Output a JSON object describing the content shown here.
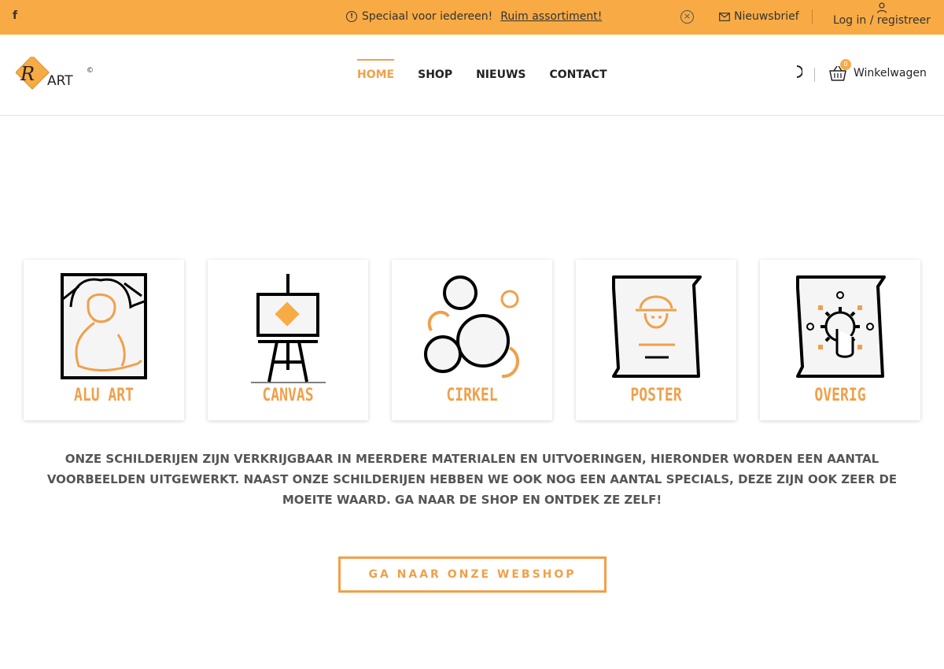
{
  "topbar": {
    "social_icon": "facebook-icon",
    "social_label": "f",
    "promo_text": "Speciaal voor iedereen!",
    "promo_link": "Ruim assortiment!",
    "newsletter_label": "Nieuwsbrief",
    "login_label": "Log in / registreer"
  },
  "header": {
    "logo_text": "ART",
    "logo_mark": "R",
    "logo_copyright": "©",
    "nav": [
      {
        "label": "HOME"
      },
      {
        "label": "SHOP"
      },
      {
        "label": "NIEUWS"
      },
      {
        "label": "CONTACT"
      }
    ],
    "cart_count": "0",
    "cart_label": "Winkelwagen"
  },
  "categories": [
    {
      "label": "ALU ART",
      "icon": "mona-lisa-icon"
    },
    {
      "label": "CANVAS",
      "icon": "easel-icon"
    },
    {
      "label": "CIRKEL",
      "icon": "circles-icon"
    },
    {
      "label": "POSTER",
      "icon": "poster-icon"
    },
    {
      "label": "OVERIG",
      "icon": "touch-gear-icon"
    }
  ],
  "intro_text": "ONZE SCHILDERIJEN ZIJN VERKRIJGBAAR IN MEERDERE MATERIALEN EN UITVOERINGEN, HIERONDER WORDEN EEN AANTAL VOORBEELDEN UITGEWERKT. NAAST ONZE SCHILDERIJEN HEBBEN WE OOK NOG EEN AANTAL SPECIALS, DEZE ZIJN OOK ZEER DE MOEITE WAARD. GA NAAR DE SHOP EN ONTDEK ZE ZELF!",
  "cta_label": "GA NAAR ONZE WEBSHOP",
  "colors": {
    "accent": "#f8ab45",
    "accent_text": "#f0a04a"
  }
}
